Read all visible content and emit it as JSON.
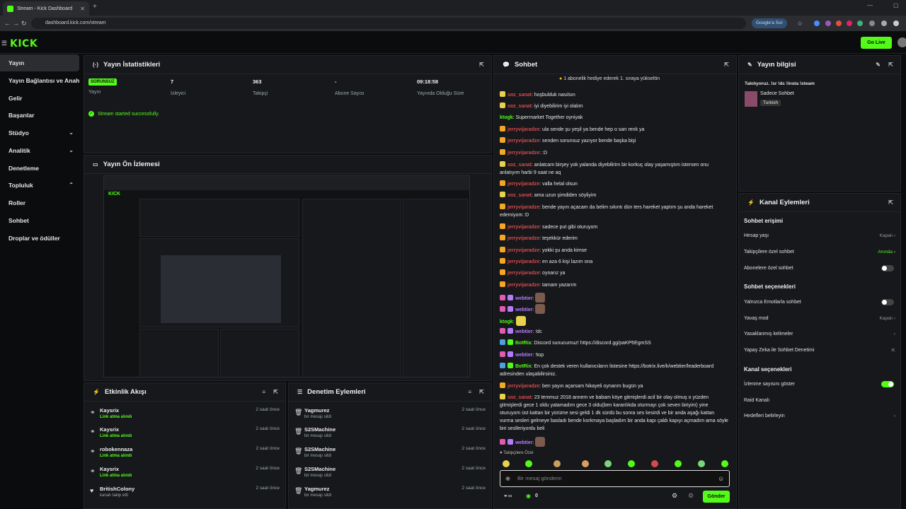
{
  "browser": {
    "tab_title": "Stream - Kick Dashboard",
    "url": "dashboard.kick.com/stream",
    "google_label": "Google'a Sor"
  },
  "app": {
    "logo": "KICK",
    "go_live": "Go Live"
  },
  "sidebar": {
    "items": [
      {
        "label": "Yayın"
      },
      {
        "label": "Yayın Bağlantısı ve Anahtarı"
      },
      {
        "label": "Gelir"
      },
      {
        "label": "Başarılar"
      },
      {
        "label": "Stüdyo"
      },
      {
        "label": "Analitik"
      },
      {
        "label": "Denetleme"
      },
      {
        "label": "Topluluk"
      },
      {
        "label": "Roller"
      },
      {
        "label": "Sohbet"
      },
      {
        "label": "Droplar ve ödüller"
      }
    ]
  },
  "stats": {
    "title": "Yayın İstatistikleri",
    "badge": "SORUNSUZ",
    "items": [
      {
        "value": "",
        "label": "Yayın"
      },
      {
        "value": "7",
        "label": "İzleyici"
      },
      {
        "value": "363",
        "label": "Takipçi"
      },
      {
        "value": "-",
        "label": "Abone Sayısı"
      },
      {
        "value": "09:18:58",
        "label": "Yayında Olduğu Süre"
      }
    ],
    "success": "Stream started successfully."
  },
  "preview": {
    "title": "Yayın Ön İzlemesi"
  },
  "activity": {
    "title": "Etkinlik Akışı",
    "rows": [
      {
        "name": "Kaysrix",
        "sub": "Link atma alındı",
        "time": "2 saat önce"
      },
      {
        "name": "Kaysrix",
        "sub": "Link atma alındı",
        "time": "2 saat önce"
      },
      {
        "name": "robokennaza",
        "sub": "Link atma alındı",
        "time": "2 saat önce"
      },
      {
        "name": "Kaysrix",
        "sub": "Link atma alındı",
        "time": "2 saat önce"
      },
      {
        "name": "BritishColony",
        "sub": "kanalı takip etti",
        "time": "2 saat önce"
      }
    ]
  },
  "moderation": {
    "title": "Denetim Eylemleri",
    "rows": [
      {
        "name": "Yagmurez",
        "sub": "bir mesajı sildi",
        "time": "2 saat önce"
      },
      {
        "name": "S2SMachine",
        "sub": "bir mesajı sildi",
        "time": "2 saat önce"
      },
      {
        "name": "S2SMachine",
        "sub": "bir mesajı sildi",
        "time": "2 saat önce"
      },
      {
        "name": "S2SMachine",
        "sub": "bir mesajı sildi",
        "time": "2 saat önce"
      },
      {
        "name": "Yagmurez",
        "sub": "bir mesajı sildi",
        "time": "2 saat önce"
      }
    ]
  },
  "chat": {
    "title": "Sohbet",
    "pinned": "1 abonelik hediye ederek 1. sıraya yükseltin",
    "messages": [
      {
        "user": "soz_sanat",
        "color": "#d24b4b",
        "badge": "#e8d24b",
        "text": "hoşbulduk nasılsın"
      },
      {
        "user": "soz_sanat",
        "color": "#d24b4b",
        "badge": "#e8d24b",
        "text": "iyi diyebilirim iyi olalım"
      },
      {
        "user": "ktogk",
        "color": "#53fc18",
        "badge": "",
        "text": "Supermarket Together oyniyak"
      },
      {
        "user": "jerryvijaradze",
        "color": "#d24b4b",
        "badge": "#f5a623",
        "text": "ula sende şu yeşil ya bende hep o sarı renk ya"
      },
      {
        "user": "jerryvijaradze",
        "color": "#d24b4b",
        "badge": "#f5a623",
        "text": "senden sorunsuz yazıyor bende başka bişi"
      },
      {
        "user": "jerryvijaradze",
        "color": "#d24b4b",
        "badge": "#f5a623",
        "text": ":D"
      },
      {
        "user": "soz_sanat",
        "color": "#d24b4b",
        "badge": "#e8d24b",
        "text": "anlatcam birşey yok yalanda diyebilirim bir korkuç olay yaşamıştım istersen onu anlatıyım harbi 9 saat ne aq"
      },
      {
        "user": "jerryvijaradze",
        "color": "#d24b4b",
        "badge": "#f5a623",
        "text": "valla helal olsun"
      },
      {
        "user": "soz_sanat",
        "color": "#d24b4b",
        "badge": "#e8d24b",
        "text": "ama uzun şimdiden söyliyim"
      },
      {
        "user": "jerryvijaradze",
        "color": "#d24b4b",
        "badge": "#f5a623",
        "text": "bende yayın açacam da belim sıkıntı dün ters hareket yaptım şu anda hareket edemiyom :D"
      },
      {
        "user": "jerryvijaradze",
        "color": "#d24b4b",
        "badge": "#f5a623",
        "text": "sadece put gibi oturuyom"
      },
      {
        "user": "jerryvijaradze",
        "color": "#d24b4b",
        "badge": "#f5a623",
        "text": "teşekkür ederim"
      },
      {
        "user": "jerryvijaradze",
        "color": "#d24b4b",
        "badge": "#f5a623",
        "text": "yokki şu anda kimse"
      },
      {
        "user": "jerryvijaradze",
        "color": "#d24b4b",
        "badge": "#f5a623",
        "text": "en aza 6 kişi lazım ona"
      },
      {
        "user": "jerryvijaradze",
        "color": "#d24b4b",
        "badge": "#f5a623",
        "text": "oynarız ya"
      },
      {
        "user": "jerryvijaradze",
        "color": "#d24b4b",
        "badge": "#f5a623",
        "text": "tamam yazarım"
      }
    ],
    "messages2": [
      {
        "user": "webtier",
        "text": ""
      },
      {
        "user": "webtier",
        "text": ""
      },
      {
        "user": "ktogk",
        "text": ""
      },
      {
        "user": "webtier",
        "text": "!dc"
      },
      {
        "user": "BotRix",
        "text": "Discord sunucumuz! https://discord.gg/paKP6EgmSS"
      },
      {
        "user": "webtier",
        "text": "!top"
      },
      {
        "user": "BotRix",
        "text": "En çok destek veren kullanıcıların listesine https://botrix.live/k/webtier/leaderboard adresinden ulaşabilirsiniz."
      },
      {
        "user": "jerryvijaradze",
        "text": "ben yayın açarsam hikayeli oynarım bugün ya"
      },
      {
        "user": "soz_sanat",
        "text": "23 temmuz 2018 annem ve babam köye gitmişlerdi acil bir olay olmuş o yüzden gitmişlerdi gece 1 oldu yatamadım gece 3 oldu(ben karanlıkda oturmayı çok seven biriyim) yine oturuyom üst kattan bir yürüme sesi geldi 1 dk sürdü bu sonra ses kesirdi ve bir anda aşağı kattan vurma sesleri gelmeye basladı bende korkmaya başladım bir anda kapı çaldı kapıyı açmadım ama söyle biri seslleriyordu beli"
      },
      {
        "user": "webtier",
        "text": ""
      }
    ],
    "followers_only": "Takipçilere Özel",
    "placeholder": "Bir mesaj gönderin",
    "viewers": "0",
    "send": "Gönder"
  },
  "info": {
    "title": "Yayın bilgisi",
    "stream_title": "Takılıyoruz. !sr !dc !insta !steam",
    "category": "Sadece Sohbet",
    "tag": "Turkish"
  },
  "actions": {
    "title": "Kanal Eylemleri",
    "chat_access": "Sohbet erişimi",
    "account_age": "Hesap yaşı",
    "account_age_val": "Kapalı",
    "followers_chat": "Takipçilere özel sohbet",
    "followers_val": "Anında",
    "subs_chat": "Abonelere özel sohbet",
    "chat_options": "Sohbet seçenekleri",
    "emote_only": "Yalnızca Emotlarla sohbet",
    "slow_mode": "Yavaş mod",
    "slow_val": "Kapalı",
    "banned_words": "Yasaklanmış kelimeler",
    "ai_mod": "Yapay Zeka ile Sohbet Denetimi",
    "channel_options": "Kanal seçenekleri",
    "show_views": "İzlenme sayısını göster",
    "raid": "Raid Kanalı",
    "targets": "Hedefleri belirleyin"
  },
  "colors": {
    "accent": "#53fc18",
    "bg": "#0b0c0e",
    "panel": "#17181c"
  }
}
